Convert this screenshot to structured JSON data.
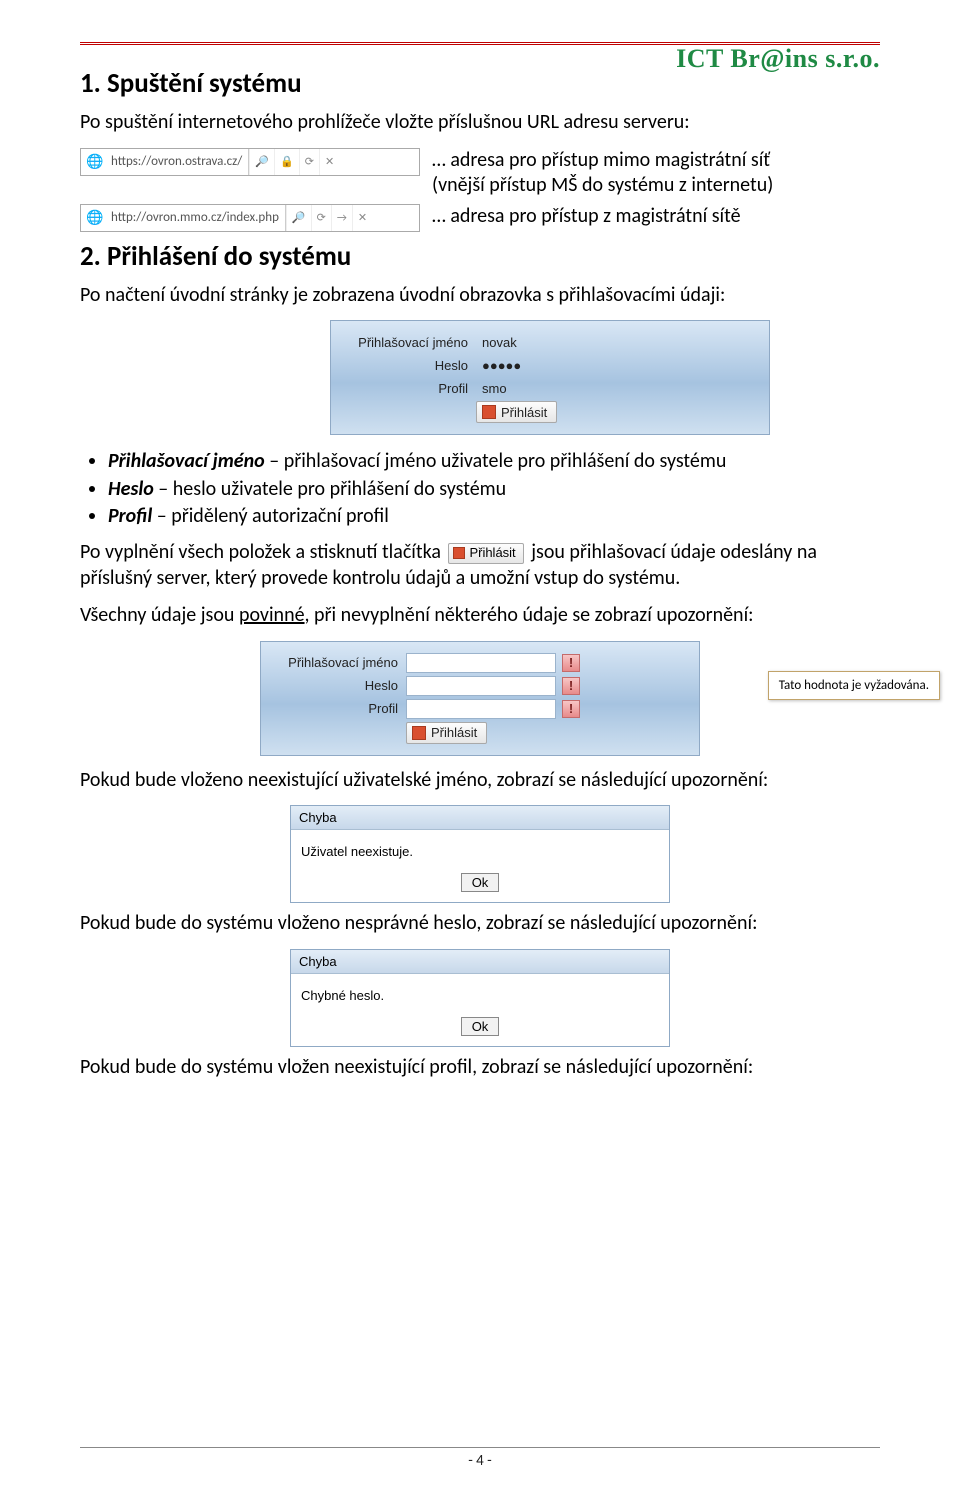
{
  "brand": "ICT Br@ins s.r.o.",
  "section1": {
    "heading": "1. Spuštění systému",
    "intro": "Po spuštění internetového prohlížeče vložte příslušnou URL adresu serveru:",
    "url1_text": "https://ovron.ostrava.cz/",
    "url1_caption_a": "… adresa pro přístup mimo magistrátní síť",
    "url1_caption_b": "(vnější přístup MŠ do systému z internetu)",
    "url2_text": "http://ovron.mmo.cz/index.php",
    "url2_caption": "… adresa pro přístup z magistrátní sítě",
    "search_placeholder_icon": "🔎"
  },
  "section2": {
    "heading": "2. Přihlášení do systému",
    "intro": "Po načtení úvodní stránky je zobrazena úvodní obrazovka s přihlašovacími údaji:"
  },
  "login1": {
    "jmeno_label": "Přihlašovací jméno",
    "jmeno_value": "novak",
    "heslo_label": "Heslo",
    "heslo_value": "●●●●●",
    "profil_label": "Profil",
    "profil_value": "smo",
    "button": "Přihlásit"
  },
  "bullets": {
    "b1_strong": "Přihlašovací jméno",
    "b1_rest": " – přihlašovací jméno uživatele pro přihlášení do systému",
    "b2_strong": "Heslo",
    "b2_rest": " – heslo uživatele pro přihlášení do systému",
    "b3_strong": "Profil",
    "b3_rest": " – přidělený autorizační profil"
  },
  "after_bullets": {
    "line1_a": "Po vyplnění všech položek a stisknutí tlačítka ",
    "btn_label": "Přihlásit",
    "line1_b": " jsou přihlašovací údaje odeslány na příslušný server, který provede kontrolu údajů a umožní vstup do systému.",
    "line2_a": "Všechny údaje jsou ",
    "line2_u": "povinné",
    "line2_b": ", při nevyplnění některého údaje se zobrazí upozornění:"
  },
  "login2": {
    "jmeno_label": "Přihlašovací jméno",
    "heslo_label": "Heslo",
    "profil_label": "Profil",
    "button": "Přihlásit",
    "tooltip": "Tato hodnota je vyžadována.",
    "warn": "!"
  },
  "warn_user": {
    "intro": "Pokud bude vloženo neexistující uživatelské jméno, zobrazí se následující upozornění:",
    "title": "Chyba",
    "msg": "Uživatel neexistuje.",
    "ok": "Ok"
  },
  "warn_pass": {
    "intro": "Pokud bude do systému vloženo nesprávné heslo, zobrazí se následující upozornění:",
    "title": "Chyba",
    "msg": "Chybné heslo.",
    "ok": "Ok"
  },
  "warn_profile": {
    "intro": "Pokud bude do systému vložen neexistující profil, zobrazí se následující upozornění:"
  },
  "footer": "- 4 -"
}
